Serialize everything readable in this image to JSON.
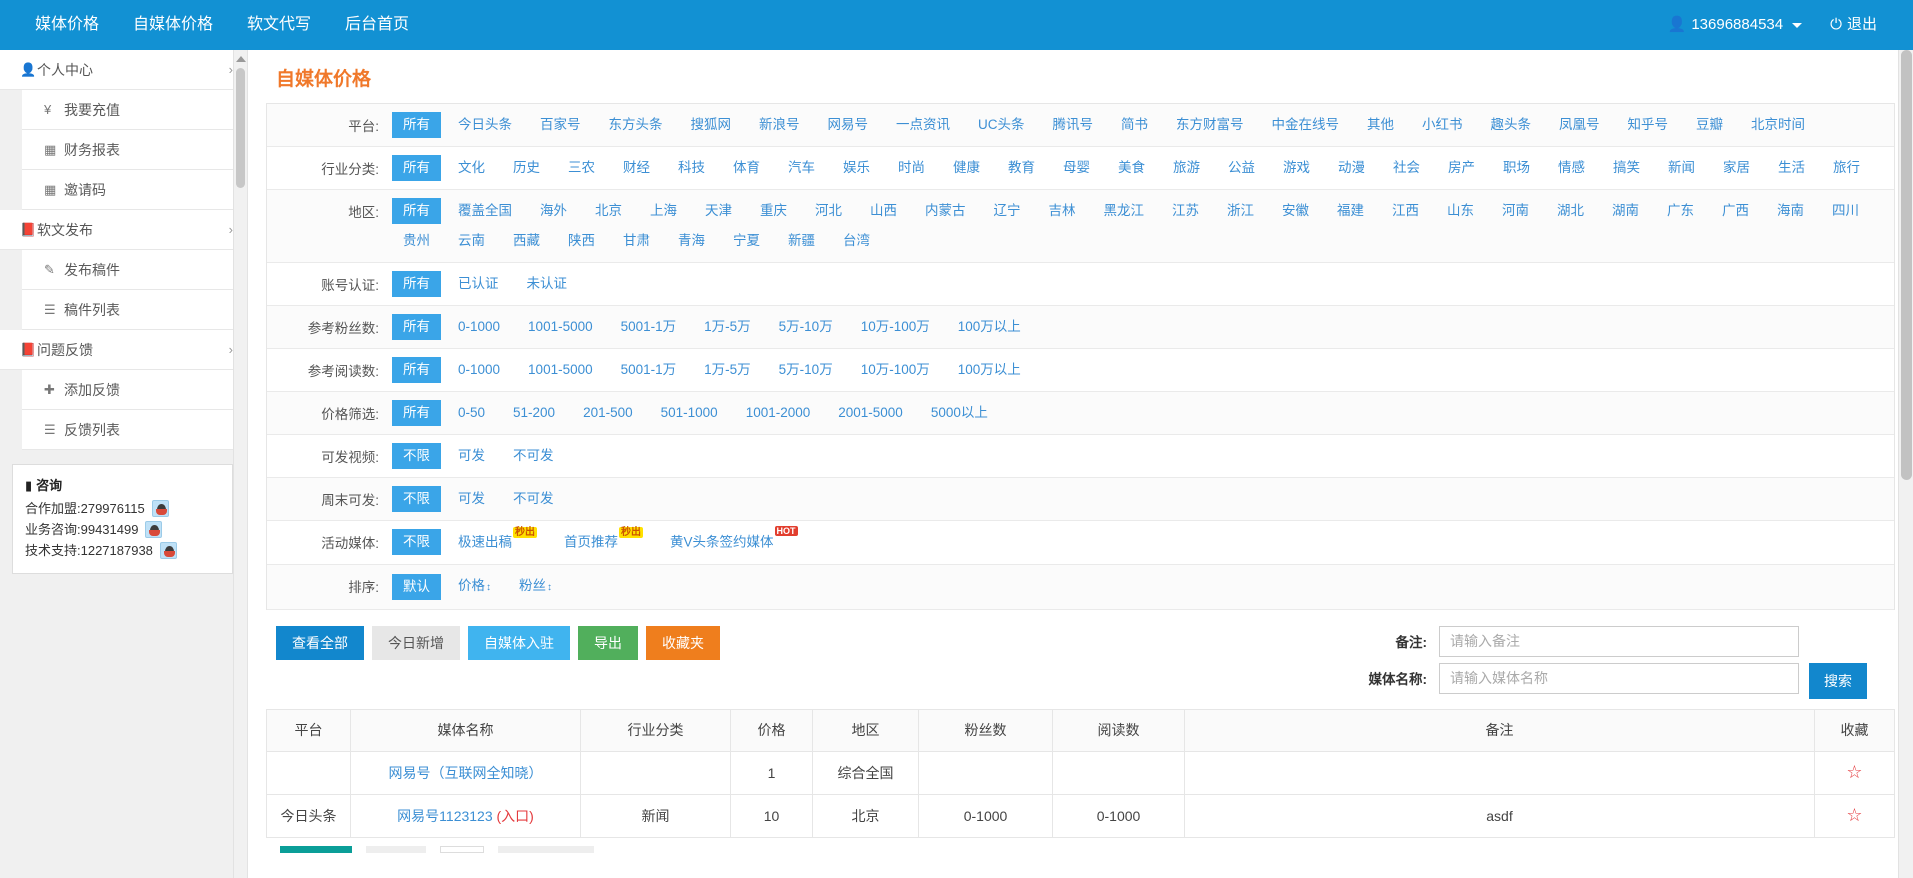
{
  "navbar": {
    "links": [
      "媒体价格",
      "自媒体价格",
      "软文代写",
      "后台首页"
    ],
    "user_icon": "user-icon",
    "username": "13696884534",
    "logout_icon": "power-icon",
    "logout": "退出"
  },
  "sidebar": {
    "groups": [
      {
        "icon": "user-icon",
        "label": "个人中心",
        "chevron": "›",
        "items": [
          {
            "icon": "¥",
            "label": "我要充值"
          },
          {
            "icon": "▦",
            "label": "财务报表"
          },
          {
            "icon": "▦",
            "label": "邀请码"
          }
        ]
      },
      {
        "icon": "book-icon",
        "label": "软文发布",
        "chevron": "›",
        "items": [
          {
            "icon": "✎",
            "label": "发布稿件"
          },
          {
            "icon": "☰",
            "label": "稿件列表"
          }
        ]
      },
      {
        "icon": "book-icon",
        "label": "问题反馈",
        "chevron": "›",
        "items": [
          {
            "icon": "✚",
            "label": "添加反馈"
          },
          {
            "icon": "☰",
            "label": "反馈列表"
          }
        ]
      }
    ],
    "contact": {
      "title": "咨询",
      "title_icon": "bookmark-icon",
      "rows": [
        {
          "label": "合作加盟:279976115",
          "icon": "qq-icon"
        },
        {
          "label": "业务咨询:99431499",
          "icon": "qq-icon"
        },
        {
          "label": "技术支持:1227187938",
          "icon": "qq-icon"
        }
      ]
    }
  },
  "main": {
    "page_title": "自媒体价格",
    "filters": [
      {
        "label": "平台:",
        "options": [
          "所有",
          "今日头条",
          "百家号",
          "东方头条",
          "搜狐网",
          "新浪号",
          "网易号",
          "一点资讯",
          "UC头条",
          "腾讯号",
          "简书",
          "东方财富号",
          "中金在线号",
          "其他",
          "小红书",
          "趣头条",
          "凤凰号",
          "知乎号",
          "豆瓣",
          "北京时间"
        ],
        "active": 0
      },
      {
        "label": "行业分类:",
        "options": [
          "所有",
          "文化",
          "历史",
          "三农",
          "财经",
          "科技",
          "体育",
          "汽车",
          "娱乐",
          "时尚",
          "健康",
          "教育",
          "母婴",
          "美食",
          "旅游",
          "公益",
          "游戏",
          "动漫",
          "社会",
          "房产",
          "职场",
          "情感",
          "搞笑",
          "新闻",
          "家居",
          "生活",
          "旅行"
        ],
        "active": 0
      },
      {
        "label": "地区:",
        "options": [
          "所有",
          "覆盖全国",
          "海外",
          "北京",
          "上海",
          "天津",
          "重庆",
          "河北",
          "山西",
          "内蒙古",
          "辽宁",
          "吉林",
          "黑龙江",
          "江苏",
          "浙江",
          "安徽",
          "福建",
          "江西",
          "山东",
          "河南",
          "湖北",
          "湖南",
          "广东",
          "广西",
          "海南",
          "四川",
          "贵州",
          "云南",
          "西藏",
          "陕西",
          "甘肃",
          "青海",
          "宁夏",
          "新疆",
          "台湾"
        ],
        "active": 0
      },
      {
        "label": "账号认证:",
        "options": [
          "所有",
          "已认证",
          "未认证"
        ],
        "active": 0
      },
      {
        "label": "参考粉丝数:",
        "options": [
          "所有",
          "0-1000",
          "1001-5000",
          "5001-1万",
          "1万-5万",
          "5万-10万",
          "10万-100万",
          "100万以上"
        ],
        "active": 0
      },
      {
        "label": "参考阅读数:",
        "options": [
          "所有",
          "0-1000",
          "1001-5000",
          "5001-1万",
          "1万-5万",
          "5万-10万",
          "10万-100万",
          "100万以上"
        ],
        "active": 0
      },
      {
        "label": "价格筛选:",
        "options": [
          "所有",
          "0-50",
          "51-200",
          "201-500",
          "501-1000",
          "1001-2000",
          "2001-5000",
          "5000以上"
        ],
        "active": 0
      },
      {
        "label": "可发视频:",
        "options": [
          "不限",
          "可发",
          "不可发"
        ],
        "active": 0
      },
      {
        "label": "周末可发:",
        "options": [
          "不限",
          "可发",
          "不可发"
        ],
        "active": 0
      },
      {
        "label": "活动媒体:",
        "options": [
          "不限",
          "极速出稿",
          "首页推荐",
          "黄V头条签约媒体"
        ],
        "active": 0,
        "badges": [
          null,
          "秒出",
          "秒出",
          "HOT"
        ]
      },
      {
        "label": "排序:",
        "options": [
          "默认",
          "价格",
          "粉丝"
        ],
        "active": 0,
        "sort_arrows": [
          false,
          true,
          true
        ]
      }
    ],
    "buttons": [
      {
        "label": "查看全部",
        "style": "primary"
      },
      {
        "label": "今日新增",
        "style": "default"
      },
      {
        "label": "自媒体入驻",
        "style": "info"
      },
      {
        "label": "导出",
        "style": "success"
      },
      {
        "label": "收藏夹",
        "style": "warning"
      }
    ],
    "search": {
      "note_label": "备注:",
      "note_placeholder": "请输入备注",
      "note_value": "",
      "media_label": "媒体名称:",
      "media_placeholder": "请输入媒体名称",
      "media_value": "",
      "search_button": "搜索"
    },
    "table": {
      "columns": [
        "平台",
        "媒体名称",
        "行业分类",
        "价格",
        "地区",
        "粉丝数",
        "阅读数",
        "备注",
        "收藏"
      ],
      "rows": [
        {
          "platform": "",
          "media_name": "网易号（互联网全知晓）",
          "media_suffix": "",
          "category": "",
          "price": "1",
          "region": "综合全国",
          "fans": "",
          "reads": "",
          "note": "",
          "favorite_icon": "star-icon"
        },
        {
          "platform": "今日头条",
          "media_name": "网易号1123123",
          "media_suffix": "(入口)",
          "category": "新闻",
          "price": "10",
          "region": "北京",
          "fans": "0-1000",
          "reads": "0-1000",
          "note": "asdf",
          "favorite_icon": "star-icon"
        }
      ]
    }
  },
  "colors": {
    "brand": "#1291d3",
    "accent_active": "#3aa5e8",
    "title": "#f0782a",
    "link": "#3c8fd4",
    "star": "#e4393c"
  }
}
